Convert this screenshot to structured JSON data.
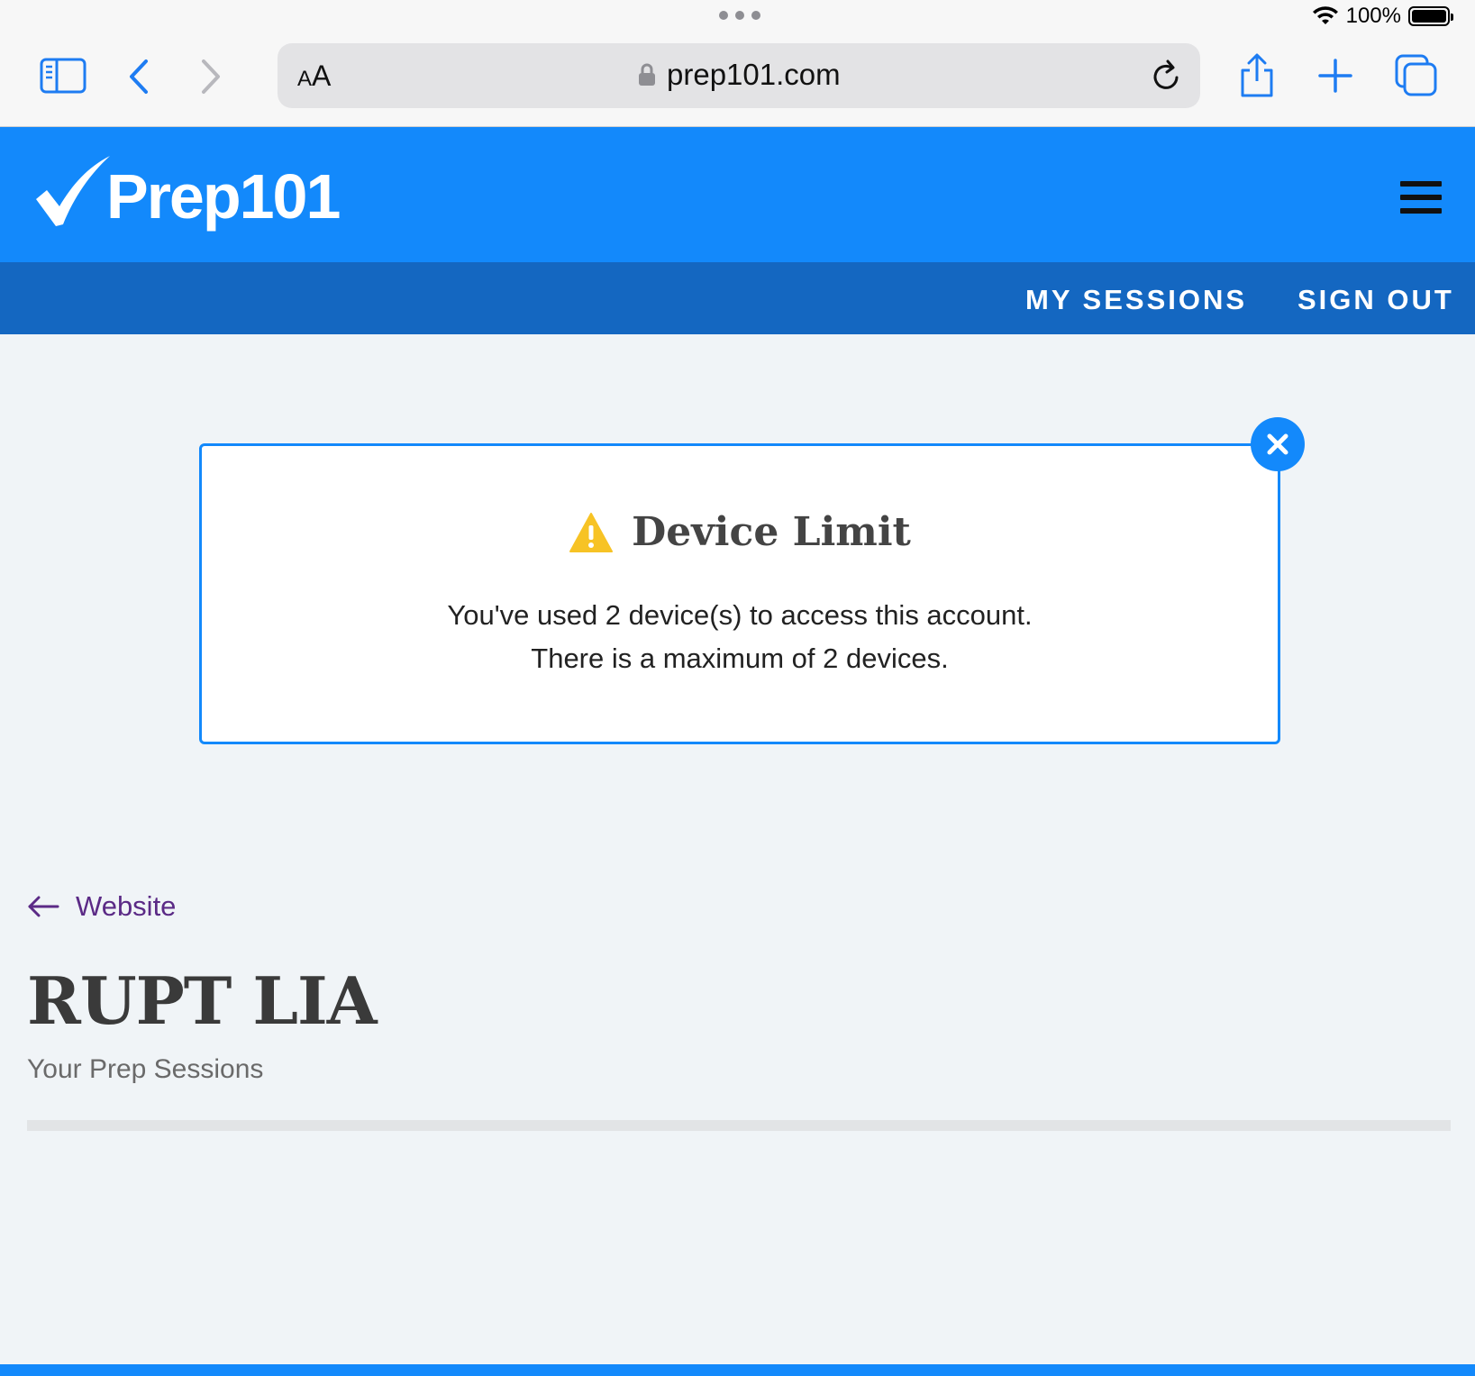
{
  "browser": {
    "battery": "100%",
    "url": "prep101.com",
    "aa_small": "A",
    "aa_large": "A"
  },
  "site": {
    "logo_text": "Prep101",
    "nav": [
      "MY SESSIONS",
      "SIGN OUT"
    ]
  },
  "modal": {
    "title": "Device Limit",
    "line1": "You've used 2 device(s) to access this account.",
    "line2": "There is a maximum of 2 devices."
  },
  "page": {
    "back_label": "Website",
    "title": "RUPT LIA",
    "subtitle": "Your Prep Sessions"
  },
  "colors": {
    "brand_blue": "#1389fb",
    "nav_blue": "#1467c1",
    "warning_yellow": "#f7c325",
    "link_purple": "#5b2a86",
    "ios_blue": "#1e7cf2"
  }
}
